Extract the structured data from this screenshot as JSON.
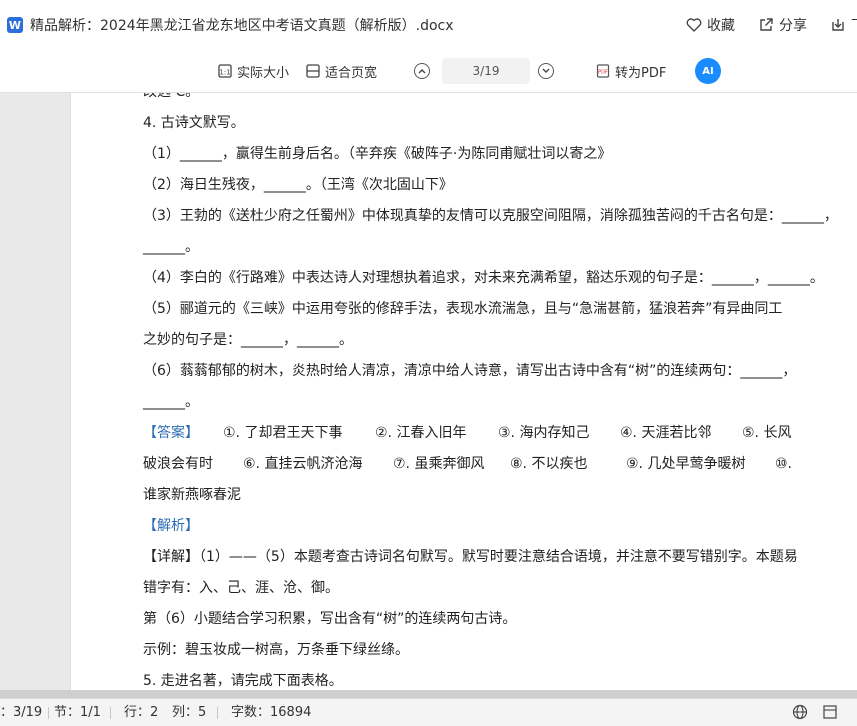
{
  "titlebar": {
    "app_icon_letter": "W",
    "doc_title": "精品解析：2024年黑龙江省龙东地区中考语文真题（解析版）.docx",
    "actions": {
      "favorite": "收藏",
      "share": "分享",
      "download": "下"
    }
  },
  "toolbar": {
    "actual_size": "实际大小",
    "fit_page": "适合页宽",
    "page_indicator": "3/19",
    "to_pdf": "转为PDF",
    "ai_label": "AI"
  },
  "document": {
    "lines": [
      "改选 C。",
      "4. 古诗文默写。",
      "（1）______，赢得生前身后名。（辛弃疾《破阵子·为陈同甫赋壮词以寄之》",
      "（2）海日生残夜，______。（王湾《次北固山下》",
      "（3）王勃的《送杜少府之任蜀州》中体现真挚的友情可以克服空间阻隔，消除孤独苦闷的千古名句是：______，",
      "______。",
      "（4）李白的《行路难》中表达诗人对理想执着追求，对未来充满希望，豁达乐观的句子是：______，______。",
      "（5）郦道元的《三峡》中运用夸张的修辞手法，表现水流湍急，且与“急湍甚箭，猛浪若奔”有异曲同工",
      "之妙的句子是：______，______。",
      "（6）蓊蓊郁郁的树木，炎热时给人清凉，清凉中给人诗意，请写出古诗中含有“树”的连续两句：______，",
      "______。"
    ],
    "answer_label": "【答案】",
    "answer_items": [
      "①. 了却君王天下事",
      "②. 江春入旧年",
      "③. 海内存知己",
      "④. 天涯若比邻",
      "⑤. 长风"
    ],
    "answer_line2": [
      "破浪会有时",
      "⑥. 直挂云帆济沧海",
      "⑦. 虽乘奔御风",
      "⑧. 不以疾也",
      "⑨. 几处早莺争暖树",
      "⑩."
    ],
    "answer_line3": "谁家新燕啄春泥",
    "analysis_label": "【解析】",
    "detail_lines": [
      "【详解】（1）——（5）本题考查古诗词名句默写。默写时要注意结合语境，并注意不要写错别字。本题易",
      "错字有：入、己、涯、沧、御。",
      "第（6）小题结合学习积累，写出含有“树”的连续两句古诗。",
      "示例：碧玉妆成一树高，万条垂下绿丝绦。",
      "5. 走进名著，请完成下面表格。"
    ]
  },
  "statusbar": {
    "page": "：3/19",
    "section": "节：1/1",
    "row": "行：2",
    "col": "列：5",
    "word_count": "字数：16894"
  }
}
